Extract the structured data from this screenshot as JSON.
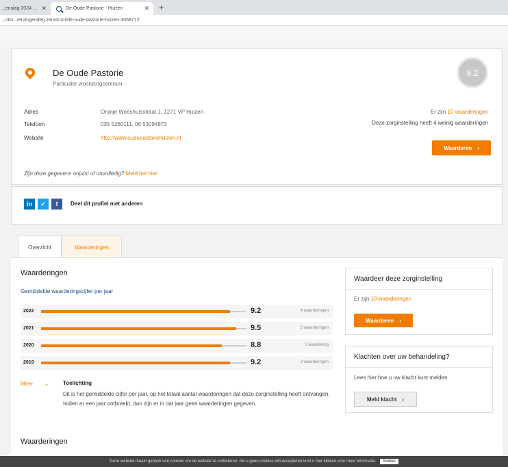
{
  "browser": {
    "tabs": [
      {
        "label": "...enslag 2024 ..."
      },
      {
        "label": "De Oude Pastorie - Huizen"
      }
    ],
    "url": "...ntio.../ervingendeg.zenstrum/de-oude-pastorie-huizen-3058772"
  },
  "org": {
    "name": "De Oude Pastorie",
    "type": "Particulier woonzorgcentrum",
    "score": "9.2",
    "address_label": "Adres",
    "address": "Oranje Weeshuisstraat 1, 1271 VP Huizen",
    "phone_label": "Telefoon",
    "phone": "035 5260111, 06 53094873",
    "website_label": "Website",
    "website": "http://www.oudepastoriehuizen.nl",
    "ratings_prefix": "Er zijn",
    "ratings_link": "10 waarderingen",
    "ratings_note": "Deze zorginstelling heeft 4 weinig waarderingen",
    "rate_button": "Waarderen",
    "wrong_data_text": "Zijn deze gegevens onjuist of onvolledig?",
    "wrong_data_link": "Meld het hier"
  },
  "share": {
    "text": "Deel dit profiel met anderen"
  },
  "page_tabs": {
    "overview": "Overzicht",
    "ratings": "Waarderingen"
  },
  "main": {
    "title": "Waarderingen",
    "subtitle": "Gemiddelde waarderingscijfer per jaar",
    "years": [
      {
        "year": "2022",
        "score": "9.2",
        "count": "4 waarderingen",
        "pct": 0.92
      },
      {
        "year": "2021",
        "score": "9.5",
        "count": "2 waarderingen",
        "pct": 0.95
      },
      {
        "year": "2020",
        "score": "8.8",
        "count": "1 waardering",
        "pct": 0.88
      },
      {
        "year": "2019",
        "score": "9.2",
        "count": "3 waarderingen",
        "pct": 0.92
      }
    ],
    "more": "Meer",
    "explanation_title": "Toelichting",
    "explanation_text": "Dit is het gemiddelde cijfer per jaar, op het totaal aantal waarderingen dat deze zorginstelling heeft ontvangen. Indien er een jaar ontbreekt, dan zijn er in dat jaar geen waarderingen gegeven.",
    "second_title": "Waarderingen"
  },
  "side": {
    "rate_title": "Waardeer deze zorginstelling",
    "rate_prefix": "Er zijn",
    "rate_link": "10 waarderingen",
    "rate_button": "Waarderen",
    "complaint_title": "Klachten over uw behandeling?",
    "complaint_text": "Lees hier hoe u uw klacht kunt melden",
    "complaint_button": "Meld klacht"
  },
  "cookie": {
    "text": "Deze website maakt gebruik van cookies om de website te verbeteren. Als u geen cookies wilt accepteren kunt u hier klikken voor meer informatie.",
    "button": "Sluiten"
  },
  "colors": {
    "accent": "#f07d00",
    "linkedin": "#0077b5",
    "twitter": "#1da1f2",
    "facebook": "#3b5998"
  }
}
